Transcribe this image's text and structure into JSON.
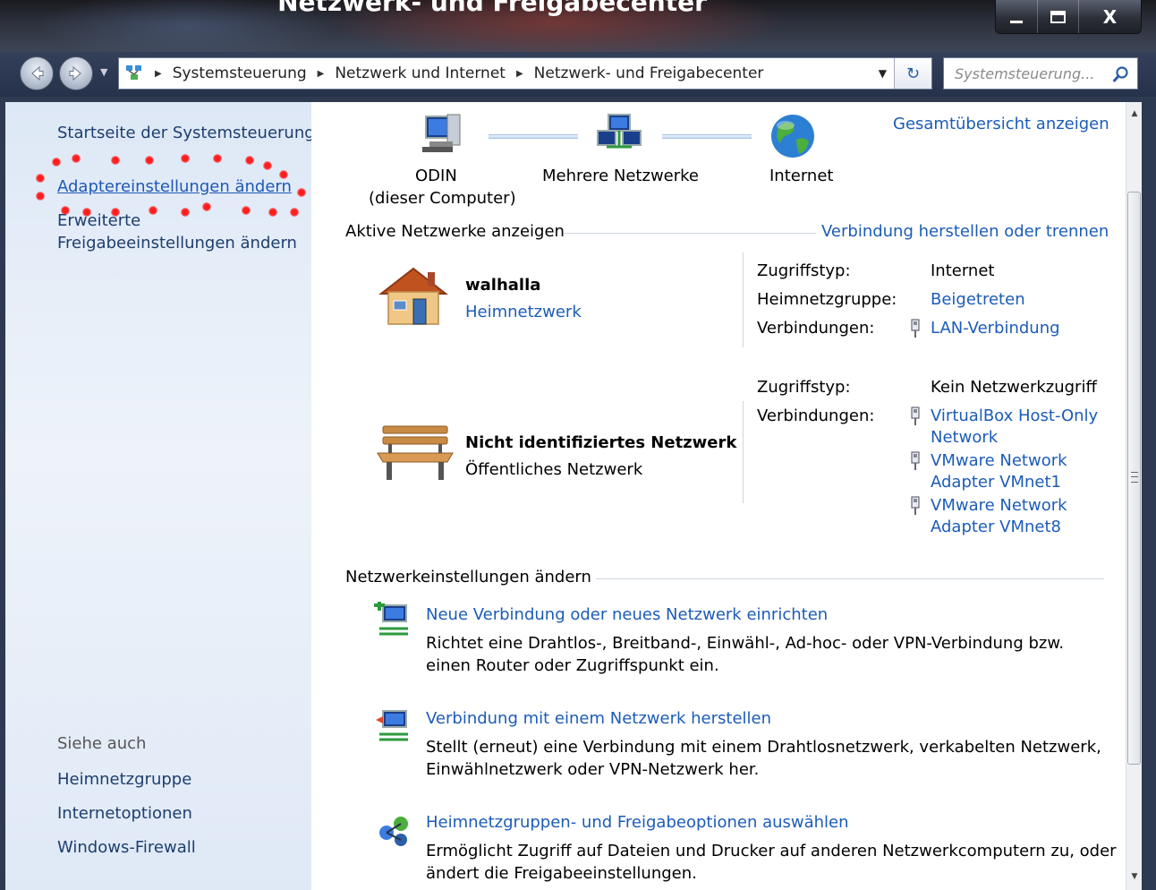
{
  "window": {
    "title": "Netzwerk- und Freigabecenter",
    "minimize": "–",
    "maximize": "□",
    "close": "X"
  },
  "address_bar": {
    "breadcrumbs": [
      "Systemsteuerung",
      "Netzwerk und Internet",
      "Netzwerk- und Freigabecenter"
    ],
    "search_placeholder": "Systemsteuerung..."
  },
  "sidebar": {
    "links": [
      {
        "label": "Startseite der Systemsteuerung"
      },
      {
        "label": "Adaptereinstellungen ändern"
      },
      {
        "label": "Erweiterte"
      },
      {
        "label": "Freigabeeinstellungen ändern"
      }
    ],
    "see_also_heading": "Siehe auch",
    "see_also": [
      {
        "label": "Heimnetzgruppe"
      },
      {
        "label": "Internetoptionen"
      },
      {
        "label": "Windows-Firewall"
      }
    ]
  },
  "network_map": {
    "full_map_link": "Gesamtübersicht anzeigen",
    "nodes": [
      {
        "label_line1": "ODIN",
        "label_line2": "(dieser Computer)"
      },
      {
        "label_line1": "Mehrere Netzwerke"
      },
      {
        "label_line1": "Internet"
      }
    ]
  },
  "active_networks": {
    "heading": "Aktive Netzwerke anzeigen",
    "connect_link": "Verbindung herstellen oder trennen",
    "networks": [
      {
        "name": "walhalla",
        "type": "Heimnetzwerk",
        "access_label": "Zugriffstyp:",
        "access_value": "Internet",
        "homegroup_label": "Heimnetzgruppe:",
        "homegroup_value": "Beigetreten",
        "connections_label": "Verbindungen:",
        "connections": [
          "LAN-Verbindung"
        ]
      },
      {
        "name": "Nicht identifiziertes Netzwerk",
        "type": "Öffentliches Netzwerk",
        "access_label": "Zugriffstyp:",
        "access_value": "Kein Netzwerkzugriff",
        "connections_label": "Verbindungen:",
        "connections": [
          {
            "line1": "VirtualBox Host-Only",
            "line2": "Network"
          },
          {
            "line1": "VMware Network",
            "line2": "Adapter VMnet1"
          },
          {
            "line1": "VMware Network",
            "line2": "Adapter VMnet8"
          }
        ]
      }
    ]
  },
  "settings": {
    "heading": "Netzwerkeinstellungen ändern",
    "tasks": [
      {
        "title": "Neue Verbindung oder neues Netzwerk einrichten",
        "desc_line1": "Richtet eine Drahtlos-, Breitband-, Einwähl-, Ad-hoc- oder VPN-Verbindung bzw.",
        "desc_line2": "einen Router oder Zugriffspunkt ein."
      },
      {
        "title": "Verbindung mit einem Netzwerk herstellen",
        "desc_line1": "Stellt (erneut) eine Verbindung mit einem Drahtlosnetzwerk, verkabelten Netzwerk,",
        "desc_line2": "Einwählnetzwerk oder VPN-Netzwerk her."
      },
      {
        "title": "Heimnetzgruppen- und Freigabeoptionen auswählen",
        "desc_line1": "Ermöglicht Zugriff auf Dateien und Drucker auf anderen Netzwerkcomputern zu, oder",
        "desc_line2": "ändert die Freigabeeinstellungen."
      }
    ]
  },
  "colors": {
    "link": "#1c5cb8",
    "sidebar_link": "#1e3e6e",
    "highlight_marker": "#ff1a1a",
    "frame": "#2e3a52"
  }
}
